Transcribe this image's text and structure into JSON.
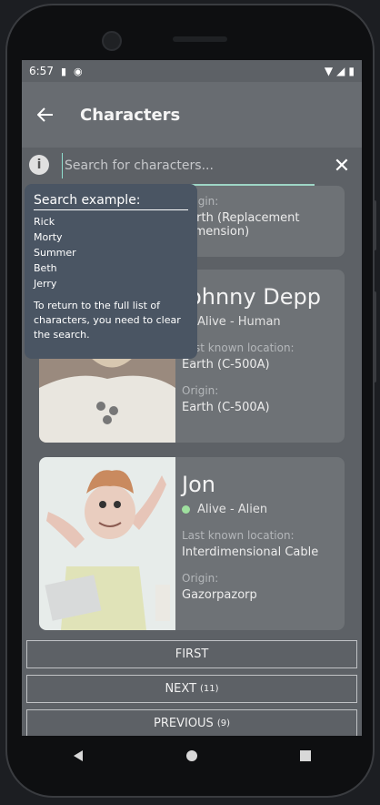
{
  "status_bar": {
    "time": "6:57"
  },
  "app_bar": {
    "title": "Characters"
  },
  "search": {
    "placeholder": "Search for characters...",
    "value": ""
  },
  "tooltip": {
    "heading": "Search example:",
    "examples": [
      "Rick",
      "Morty",
      "Summer",
      "Beth",
      "Jerry"
    ],
    "note": "To return to the full list of characters, you need to clear the search."
  },
  "cards": [
    {
      "name": "",
      "origin_label": "Origin:",
      "origin": "Earth (Replacement Dimension)"
    },
    {
      "name": "Johnny Depp",
      "status": "Alive - Human",
      "status_color": "#8bd18b",
      "location_label": "Last known location:",
      "location": "Earth (C-500A)",
      "origin_label": "Origin:",
      "origin": "Earth (C-500A)"
    },
    {
      "name": "Jon",
      "status": "Alive - Alien",
      "status_color": "#9fe09f",
      "location_label": "Last known location:",
      "location": "Interdimensional Cable",
      "origin_label": "Origin:",
      "origin": "Gazorpazorp"
    }
  ],
  "pagination": {
    "first_label": "FIRST",
    "next_label": "NEXT",
    "next_count": "(11)",
    "previous_label": "PREVIOUS",
    "previous_count": "(9)"
  }
}
